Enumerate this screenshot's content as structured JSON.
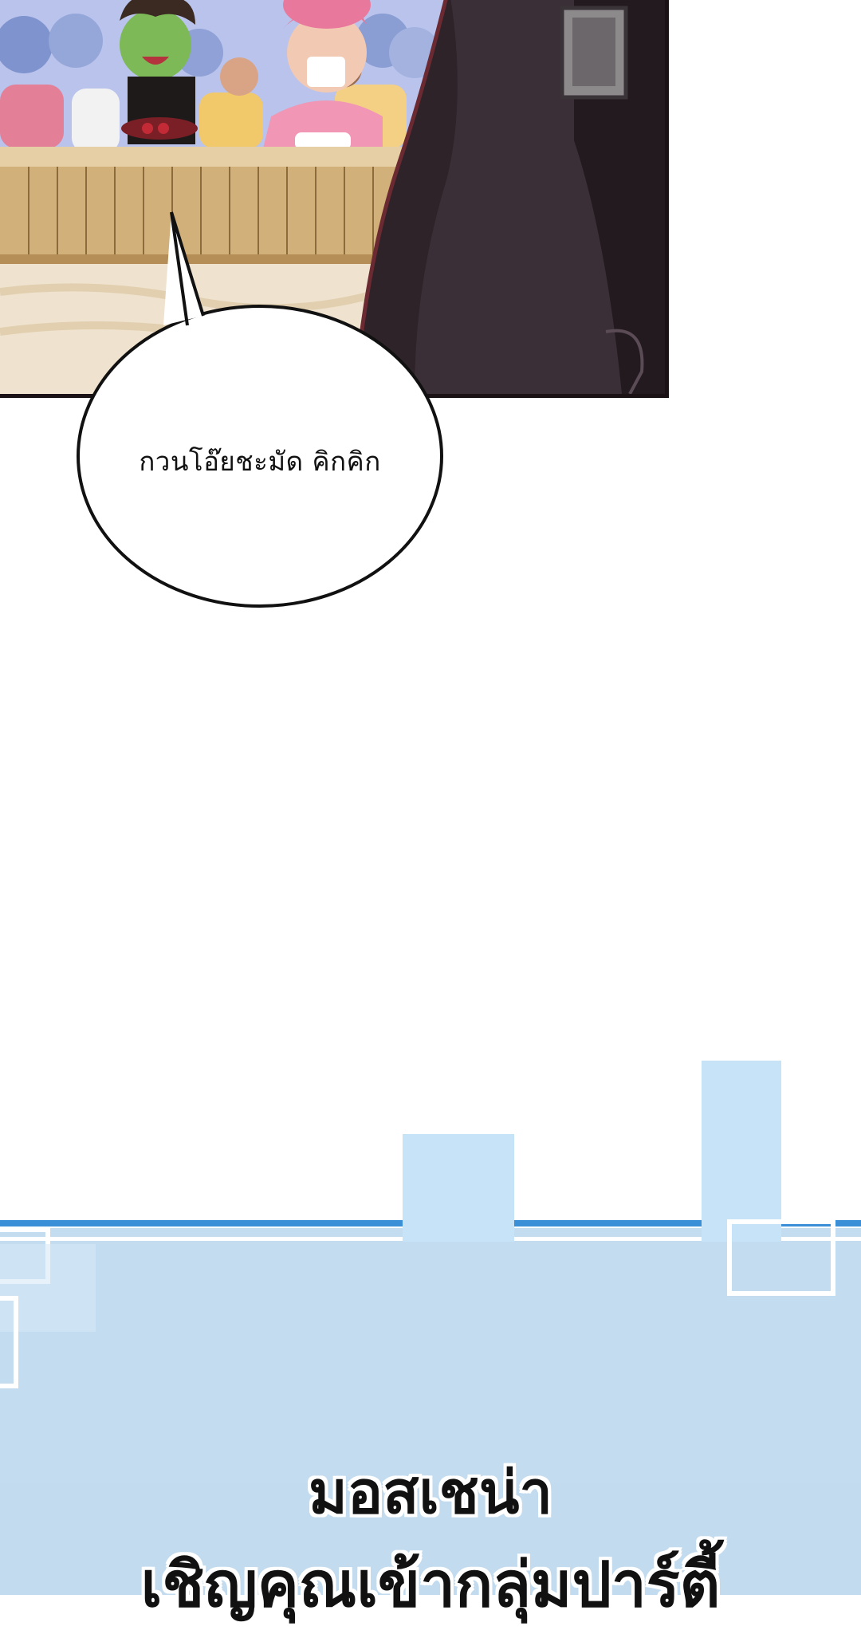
{
  "comic_panel": {
    "speech_bubble": {
      "text": "กวนโอ๊ยชะมัด คิกคิก"
    }
  },
  "banner": {
    "title": "มอสเชน่า",
    "subtitle": "เชิญคุณเข้ากลุ่มปาร์ตี้"
  },
  "colors": {
    "panel_border": "#1a1214",
    "banner_bg": "#c3dcef",
    "banner_stripe": "#3a8fd6",
    "decor_square": "#c6e3f7",
    "text": "#111111"
  }
}
